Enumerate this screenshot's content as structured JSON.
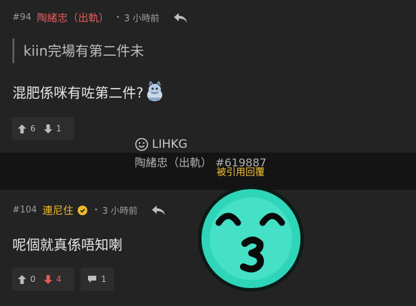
{
  "posts": [
    {
      "number": "#94",
      "username": "陶緒忠（出軌）",
      "dot": "•",
      "time": "3 小時前",
      "quote": "kiin完場有第二件未",
      "content": "混肥係咪有咗第二件?",
      "upvotes": "6",
      "downvotes": "1"
    },
    {
      "number": "#104",
      "username": "連尼住",
      "dot": "•",
      "time": "3 小時前",
      "content": "呢個就真係唔知喇",
      "upvotes": "0",
      "downvotes": "4",
      "comments": "1"
    }
  ],
  "watermark": {
    "brand": "LIHKG",
    "source": "陶緒忠（出軌） #619887",
    "tag": "被引用回覆"
  },
  "colors": {
    "username_red": "#e35b5b",
    "username_gold": "#f0b92a",
    "emoji_face": "#2fd5b8"
  },
  "icons": [
    "reply-icon",
    "upvote-icon",
    "downvote-icon",
    "comment-icon",
    "verified-icon",
    "smiley-icon",
    "sticker-icon",
    "kiss-emoji-icon"
  ]
}
